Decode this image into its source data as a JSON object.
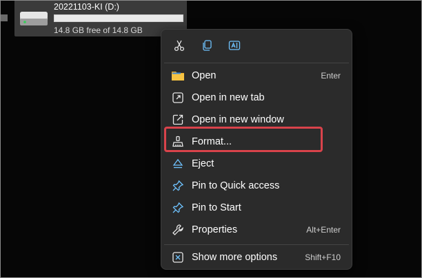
{
  "drive": {
    "name": "20221103-KI (D:)",
    "free_text": "14.8 GB free of 14.8 GB",
    "used_fraction": 0.0,
    "icon": "hard-drive-icon"
  },
  "quick_actions": [
    {
      "name": "cut",
      "icon": "scissors-icon"
    },
    {
      "name": "copy",
      "icon": "copy-icon"
    },
    {
      "name": "rename",
      "icon": "rename-icon"
    }
  ],
  "menu": {
    "items": [
      {
        "label": "Open",
        "shortcut": "Enter",
        "icon": "folder-icon"
      },
      {
        "label": "Open in new tab",
        "shortcut": "",
        "icon": "new-tab-icon"
      },
      {
        "label": "Open in new window",
        "shortcut": "",
        "icon": "new-window-icon"
      },
      {
        "label": "Format...",
        "shortcut": "",
        "icon": "format-icon"
      },
      {
        "label": "Eject",
        "shortcut": "",
        "icon": "eject-icon"
      },
      {
        "label": "Pin to Quick access",
        "shortcut": "",
        "icon": "pin-icon"
      },
      {
        "label": "Pin to Start",
        "shortcut": "",
        "icon": "pin-icon"
      },
      {
        "label": "Properties",
        "shortcut": "Alt+Enter",
        "icon": "wrench-icon"
      },
      {
        "label": "Show more options",
        "shortcut": "Shift+F10",
        "icon": "more-options-icon"
      }
    ]
  },
  "colors": {
    "menu_bg": "#2b2b2b",
    "accent_blue": "#4cc2ff",
    "highlight_red": "#d9434b",
    "folder_yellow": "#f6c343"
  }
}
